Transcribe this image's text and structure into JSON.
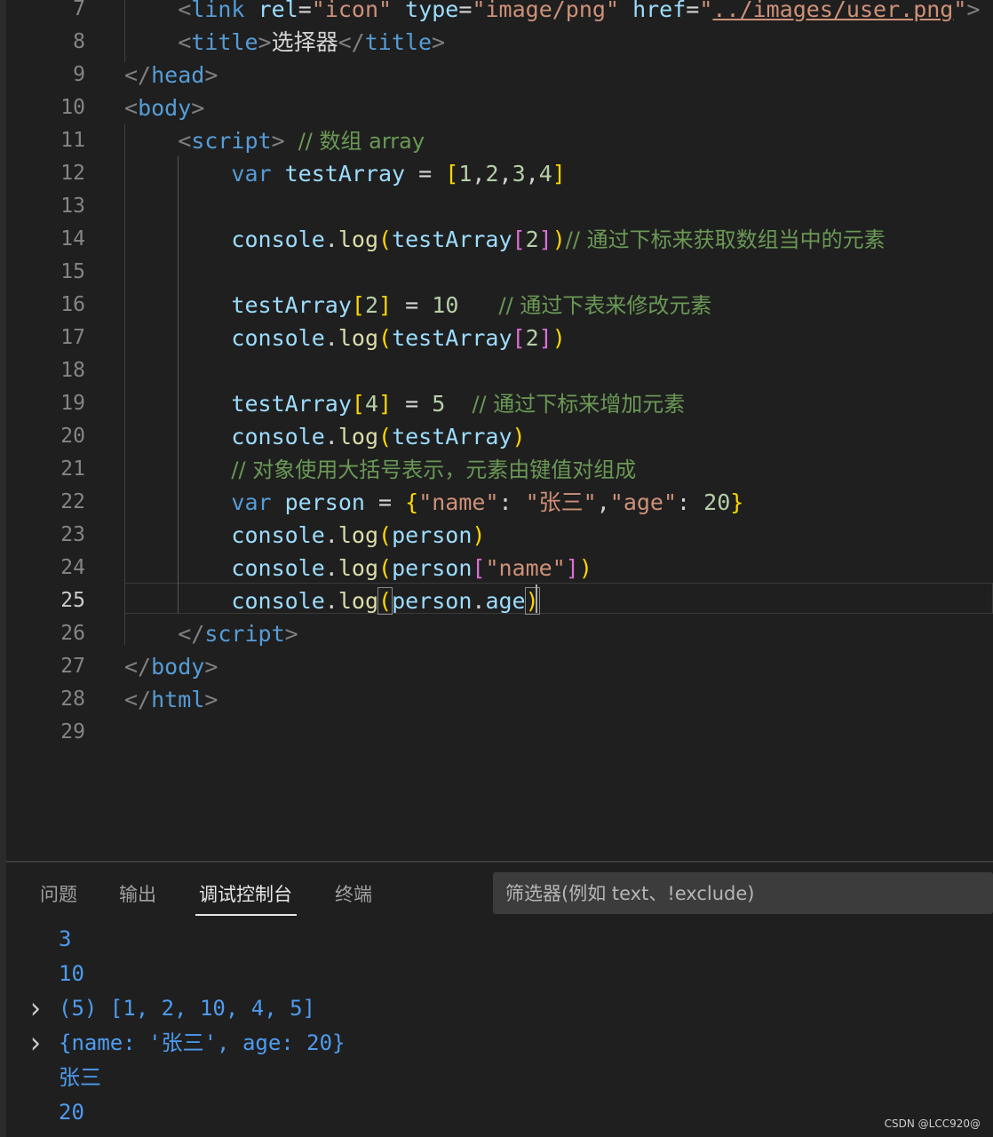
{
  "editor": {
    "line_numbers": [
      "7",
      "8",
      "9",
      "10",
      "11",
      "12",
      "13",
      "14",
      "15",
      "16",
      "17",
      "18",
      "19",
      "20",
      "21",
      "22",
      "23",
      "24",
      "25",
      "26",
      "27",
      "28",
      "29"
    ],
    "active_line": "25",
    "lines": [
      [
        {
          "t": "    ",
          "c": "txt"
        },
        {
          "t": "<",
          "c": "tag-b"
        },
        {
          "t": "link",
          "c": "tag"
        },
        {
          "t": " ",
          "c": "txt"
        },
        {
          "t": "rel",
          "c": "attr"
        },
        {
          "t": "=",
          "c": "op"
        },
        {
          "t": "\"icon\"",
          "c": "str"
        },
        {
          "t": " ",
          "c": "txt"
        },
        {
          "t": "type",
          "c": "attr"
        },
        {
          "t": "=",
          "c": "op"
        },
        {
          "t": "\"image/png\"",
          "c": "str"
        },
        {
          "t": " ",
          "c": "txt"
        },
        {
          "t": "href",
          "c": "attr"
        },
        {
          "t": "=",
          "c": "op"
        },
        {
          "t": "\"",
          "c": "str"
        },
        {
          "t": "../images/user.png",
          "c": "link"
        },
        {
          "t": "\"",
          "c": "str"
        },
        {
          "t": ">",
          "c": "tag-b"
        }
      ],
      [
        {
          "t": "    ",
          "c": "txt"
        },
        {
          "t": "<",
          "c": "tag-b"
        },
        {
          "t": "title",
          "c": "tag"
        },
        {
          "t": ">",
          "c": "tag-b"
        },
        {
          "t": "选择器",
          "c": "txt"
        },
        {
          "t": "</",
          "c": "tag-b"
        },
        {
          "t": "title",
          "c": "tag"
        },
        {
          "t": ">",
          "c": "tag-b"
        }
      ],
      [
        {
          "t": "</",
          "c": "tag-b"
        },
        {
          "t": "head",
          "c": "tag"
        },
        {
          "t": ">",
          "c": "tag-b"
        }
      ],
      [
        {
          "t": "<",
          "c": "tag-b"
        },
        {
          "t": "body",
          "c": "tag"
        },
        {
          "t": ">",
          "c": "tag-b"
        }
      ],
      [
        {
          "t": "    ",
          "c": "txt"
        },
        {
          "t": "<",
          "c": "tag-b"
        },
        {
          "t": "script",
          "c": "tag"
        },
        {
          "t": ">",
          "c": "tag-b"
        },
        {
          "t": " ",
          "c": "txt"
        },
        {
          "t": "// 数组 array",
          "c": "cmt"
        }
      ],
      [
        {
          "t": "        ",
          "c": "txt"
        },
        {
          "t": "var",
          "c": "kw"
        },
        {
          "t": " testArray ",
          "c": "var"
        },
        {
          "t": "=",
          "c": "op"
        },
        {
          "t": " ",
          "c": "txt"
        },
        {
          "t": "[",
          "c": "br1"
        },
        {
          "t": "1",
          "c": "num"
        },
        {
          "t": ",",
          "c": "op"
        },
        {
          "t": "2",
          "c": "num"
        },
        {
          "t": ",",
          "c": "op"
        },
        {
          "t": "3",
          "c": "num"
        },
        {
          "t": ",",
          "c": "op"
        },
        {
          "t": "4",
          "c": "num"
        },
        {
          "t": "]",
          "c": "br1"
        }
      ],
      [],
      [
        {
          "t": "        ",
          "c": "txt"
        },
        {
          "t": "console",
          "c": "var"
        },
        {
          "t": ".",
          "c": "op"
        },
        {
          "t": "log",
          "c": "fn"
        },
        {
          "t": "(",
          "c": "br1"
        },
        {
          "t": "testArray",
          "c": "var"
        },
        {
          "t": "[",
          "c": "br2"
        },
        {
          "t": "2",
          "c": "num"
        },
        {
          "t": "]",
          "c": "br2"
        },
        {
          "t": ")",
          "c": "br1"
        },
        {
          "t": "// 通过下标来获取数组当中的元素",
          "c": "cmt"
        }
      ],
      [],
      [
        {
          "t": "        ",
          "c": "txt"
        },
        {
          "t": "testArray",
          "c": "var"
        },
        {
          "t": "[",
          "c": "br1"
        },
        {
          "t": "2",
          "c": "num"
        },
        {
          "t": "]",
          "c": "br1"
        },
        {
          "t": " ",
          "c": "txt"
        },
        {
          "t": "=",
          "c": "op"
        },
        {
          "t": " ",
          "c": "txt"
        },
        {
          "t": "10",
          "c": "num"
        },
        {
          "t": "   ",
          "c": "txt"
        },
        {
          "t": "// 通过下表来修改元素",
          "c": "cmt"
        }
      ],
      [
        {
          "t": "        ",
          "c": "txt"
        },
        {
          "t": "console",
          "c": "var"
        },
        {
          "t": ".",
          "c": "op"
        },
        {
          "t": "log",
          "c": "fn"
        },
        {
          "t": "(",
          "c": "br1"
        },
        {
          "t": "testArray",
          "c": "var"
        },
        {
          "t": "[",
          "c": "br2"
        },
        {
          "t": "2",
          "c": "num"
        },
        {
          "t": "]",
          "c": "br2"
        },
        {
          "t": ")",
          "c": "br1"
        }
      ],
      [],
      [
        {
          "t": "        ",
          "c": "txt"
        },
        {
          "t": "testArray",
          "c": "var"
        },
        {
          "t": "[",
          "c": "br1"
        },
        {
          "t": "4",
          "c": "num"
        },
        {
          "t": "]",
          "c": "br1"
        },
        {
          "t": " ",
          "c": "txt"
        },
        {
          "t": "=",
          "c": "op"
        },
        {
          "t": " ",
          "c": "txt"
        },
        {
          "t": "5",
          "c": "num"
        },
        {
          "t": "  ",
          "c": "txt"
        },
        {
          "t": "// 通过下标来增加元素",
          "c": "cmt"
        }
      ],
      [
        {
          "t": "        ",
          "c": "txt"
        },
        {
          "t": "console",
          "c": "var"
        },
        {
          "t": ".",
          "c": "op"
        },
        {
          "t": "log",
          "c": "fn"
        },
        {
          "t": "(",
          "c": "br1"
        },
        {
          "t": "testArray",
          "c": "var"
        },
        {
          "t": ")",
          "c": "br1"
        }
      ],
      [
        {
          "t": "        ",
          "c": "txt"
        },
        {
          "t": "// 对象使用大括号表示，元素由键值对组成",
          "c": "cmt"
        }
      ],
      [
        {
          "t": "        ",
          "c": "txt"
        },
        {
          "t": "var",
          "c": "kw"
        },
        {
          "t": " person ",
          "c": "var"
        },
        {
          "t": "=",
          "c": "op"
        },
        {
          "t": " ",
          "c": "txt"
        },
        {
          "t": "{",
          "c": "br1"
        },
        {
          "t": "\"name\"",
          "c": "str"
        },
        {
          "t": ": ",
          "c": "op"
        },
        {
          "t": "\"张三\"",
          "c": "str"
        },
        {
          "t": ",",
          "c": "op"
        },
        {
          "t": "\"age\"",
          "c": "str"
        },
        {
          "t": ": ",
          "c": "op"
        },
        {
          "t": "20",
          "c": "num"
        },
        {
          "t": "}",
          "c": "br1"
        }
      ],
      [
        {
          "t": "        ",
          "c": "txt"
        },
        {
          "t": "console",
          "c": "var"
        },
        {
          "t": ".",
          "c": "op"
        },
        {
          "t": "log",
          "c": "fn"
        },
        {
          "t": "(",
          "c": "br1"
        },
        {
          "t": "person",
          "c": "var"
        },
        {
          "t": ")",
          "c": "br1"
        }
      ],
      [
        {
          "t": "        ",
          "c": "txt"
        },
        {
          "t": "console",
          "c": "var"
        },
        {
          "t": ".",
          "c": "op"
        },
        {
          "t": "log",
          "c": "fn"
        },
        {
          "t": "(",
          "c": "br1"
        },
        {
          "t": "person",
          "c": "var"
        },
        {
          "t": "[",
          "c": "br2"
        },
        {
          "t": "\"name\"",
          "c": "str"
        },
        {
          "t": "]",
          "c": "br2"
        },
        {
          "t": ")",
          "c": "br1"
        }
      ],
      [
        {
          "t": "        ",
          "c": "txt"
        },
        {
          "t": "console",
          "c": "var"
        },
        {
          "t": ".",
          "c": "op"
        },
        {
          "t": "log",
          "c": "fn"
        },
        {
          "t": "(",
          "c": "br1 brm"
        },
        {
          "t": "person",
          "c": "var"
        },
        {
          "t": ".",
          "c": "op"
        },
        {
          "t": "age",
          "c": "var"
        },
        {
          "t": ")",
          "c": "br1 brm"
        }
      ],
      [
        {
          "t": "    ",
          "c": "txt"
        },
        {
          "t": "</",
          "c": "tag-b"
        },
        {
          "t": "script",
          "c": "tag"
        },
        {
          "t": ">",
          "c": "tag-b"
        }
      ],
      [
        {
          "t": "</",
          "c": "tag-b"
        },
        {
          "t": "body",
          "c": "tag"
        },
        {
          "t": ">",
          "c": "tag-b"
        }
      ],
      [
        {
          "t": "</",
          "c": "tag-b"
        },
        {
          "t": "html",
          "c": "tag"
        },
        {
          "t": ">",
          "c": "tag-b"
        }
      ],
      []
    ]
  },
  "panel": {
    "tabs": [
      {
        "label": "问题",
        "active": false
      },
      {
        "label": "输出",
        "active": false
      },
      {
        "label": "调试控制台",
        "active": true
      },
      {
        "label": "终端",
        "active": false
      }
    ],
    "filter_placeholder": "筛选器(例如 text、!exclude)",
    "output": [
      {
        "text": "3",
        "expandable": false
      },
      {
        "text": "10",
        "expandable": false
      },
      {
        "text": "(5) [1, 2, 10, 4, 5]",
        "expandable": true
      },
      {
        "text": "{name: '张三', age: 20}",
        "expandable": true
      },
      {
        "text": "张三",
        "expandable": false
      },
      {
        "text": "20",
        "expandable": false
      }
    ]
  },
  "watermark": "CSDN @LCC920@",
  "colors": {
    "background": "#1f1f1f",
    "console_output": "#4e9bf0",
    "comment": "#6a9955",
    "keyword": "#569cd6",
    "string": "#ce9178",
    "function": "#dcdcaa",
    "number": "#b5cea8",
    "bracket_gold": "#ffd700",
    "bracket_purple": "#da70d6"
  }
}
